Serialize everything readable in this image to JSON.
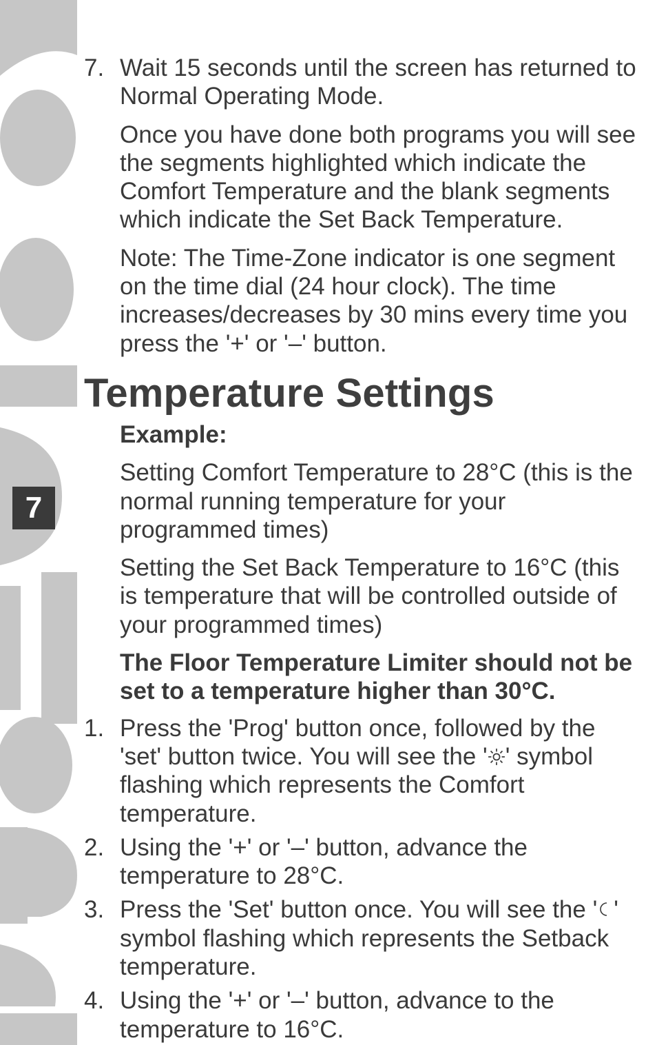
{
  "page_number": "7",
  "list1": {
    "item7": {
      "num": "7.",
      "p1": "Wait 15 seconds until the screen has returned to Normal Operating Mode.",
      "p2": "Once you have done both programs you will see the segments highlighted which indicate the Comfort Temperature and the blank segments which indicate the Set Back Temperature.",
      "p3": "Note: The Time-Zone indicator is one segment on the time dial (24 hour clock). The time increases/decreases by 30 mins every time you press the '+' or '–' button."
    }
  },
  "heading": "Temperature Settings",
  "example_label": "Example:",
  "example": {
    "p1": "Setting Comfort Temperature to 28°C (this is the normal running temperature for your programmed times)",
    "p2": "Setting the Set Back Temperature to 16°C (this is temperature that will be controlled outside of your programmed times)",
    "p3": "The Floor Temperature Limiter should not be set to a temperature higher than 30°C."
  },
  "list2": {
    "item1": {
      "num": "1.",
      "t1": "Press the 'Prog' button once, followed by the 'set' button twice. You will see the '",
      "t2": "' symbol flashing which represents the Comfort temperature."
    },
    "item2": {
      "num": "2.",
      "t": "Using the '+' or '–' button, advance the temperature to 28°C."
    },
    "item3": {
      "num": "3.",
      "t1": "Press the 'Set' button once. You will see the '",
      "t2": "' symbol flashing which represents the Setback temperature."
    },
    "item4": {
      "num": "4.",
      "t": "Using the '+' or '–' button, advance to the temperature to 16°C."
    }
  },
  "icons": {
    "sun": "sun-icon",
    "moon": "moon-icon"
  }
}
